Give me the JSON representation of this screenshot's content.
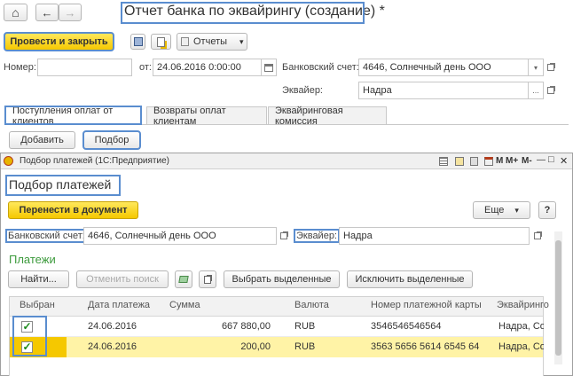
{
  "window": {
    "title": "Отчет банка по эквайрингу (создание) *",
    "nav_home": "⌂",
    "nav_back": "←",
    "nav_forward": "→"
  },
  "toolbar": {
    "post_close": "Провести и закрыть",
    "reports": "Отчеты",
    "reports_arrow": "▾"
  },
  "form": {
    "number_label": "Номер:",
    "number_value": "",
    "from_label": "от:",
    "date_value": "24.06.2016  0:00:00",
    "bank_account_label": "Банковский счет:",
    "bank_account_value": "4646, Солнечный день ООО",
    "acquirer_label": "Эквайер:",
    "acquirer_value": "Надра"
  },
  "tabs": [
    {
      "label": "Поступления оплат от клиентов"
    },
    {
      "label": "Возвраты оплат клиентам"
    },
    {
      "label": "Эквайринговая комиссия"
    }
  ],
  "tab_toolbar": {
    "add": "Добавить",
    "select": "Подбор"
  },
  "sub": {
    "title": "Подбор платежей  (1С:Предприятие)",
    "ctrl_m": "M",
    "ctrl_mplus": "M+",
    "ctrl_mminus": "M-",
    "ctrl_min": "—",
    "ctrl_max": "□",
    "ctrl_close": "✕",
    "heading": "Подбор платежей",
    "transfer": "Перенести в документ",
    "more": "Еще",
    "more_arrow": "▾",
    "help": "?",
    "bank_account_label": "Банковский счет:",
    "bank_account_value": "4646, Солнечный день ООО",
    "acquirer_label": "Эквайер:",
    "acquirer_value": "Надра",
    "payments_label": "Платежи",
    "find": "Найти...",
    "cancel_search": "Отменить поиск",
    "select_marked": "Выбрать выделенные",
    "exclude_marked": "Исключить выделенные"
  },
  "table": {
    "headers": [
      "Выбран",
      "Дата платежа",
      "Сумма",
      "Валюта",
      "Номер платежной карты",
      "Эквайринго"
    ],
    "rows": [
      {
        "date": "24.06.2016",
        "amount": "667 880,00",
        "currency": "RUB",
        "card": "3546546546564",
        "acquirer": "Надра, Сол"
      },
      {
        "date": "24.06.2016",
        "amount": "200,00",
        "currency": "RUB",
        "card": "3563 5656 5614 6545 64",
        "acquirer": "Надра, Сол"
      }
    ]
  },
  "colors": {
    "accent_yellow": "#f5c800",
    "highlight_blue": "#5a8dcf",
    "payments_green": "#3c9a3c",
    "selected_row": "#fff3a6"
  }
}
